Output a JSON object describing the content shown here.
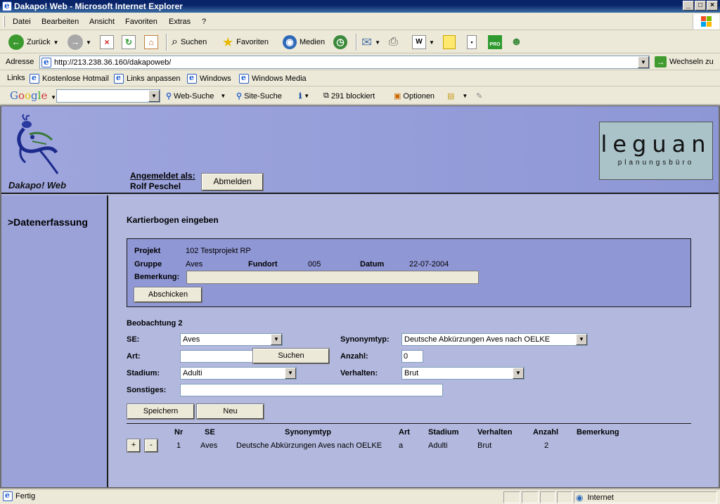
{
  "window": {
    "title": "Dakapo! Web - Microsoft Internet Explorer"
  },
  "menu": [
    "Datei",
    "Bearbeiten",
    "Ansicht",
    "Favoriten",
    "Extras",
    "?"
  ],
  "toolbar": {
    "back": "Zurück",
    "search": "Suchen",
    "favorites": "Favoriten",
    "media": "Medien"
  },
  "address": {
    "label": "Adresse",
    "url": "http://213.238.36.160/dakapoweb/",
    "go": "Wechseln zu"
  },
  "links": {
    "label": "Links",
    "items": [
      "Kostenlose Hotmail",
      "Links anpassen",
      "Windows",
      "Windows Media"
    ]
  },
  "google": {
    "logo": "Google",
    "web_search": "Web-Suche",
    "site_search": "Site-Suche",
    "blocked": "291 blockiert",
    "options": "Optionen"
  },
  "header": {
    "brand": "Dakapo! Web",
    "login_label": "Angemeldet als:",
    "login_name": "Rolf Peschel",
    "logout": "Abmelden",
    "logo_main": "leguan",
    "logo_sub": "planungsbüro"
  },
  "sidebar": {
    "nav_item": ">Datenerfassung"
  },
  "content": {
    "title": "Kartierbogen eingeben",
    "project": {
      "projekt_label": "Projekt",
      "projekt_value": "102 Testprojekt RP",
      "gruppe_label": "Gruppe",
      "gruppe_value": "Aves",
      "fundort_label": "Fundort",
      "fundort_value": "005",
      "datum_label": "Datum",
      "datum_value": "22-07-2004",
      "bemerkung_label": "Bemerkung:",
      "bemerkung_value": "",
      "submit": "Abschicken"
    },
    "observation": {
      "heading": "Beobachtung 2",
      "se_label": "SE:",
      "se_value": "Aves",
      "synonymtyp_label": "Synonymtyp:",
      "synonymtyp_value": "Deutsche Abkürzungen Aves nach OELKE",
      "art_label": "Art:",
      "art_value": "",
      "search_button": "Suchen",
      "anzahl_label": "Anzahl:",
      "anzahl_value": "0",
      "stadium_label": "Stadium:",
      "stadium_value": "Adulti",
      "verhalten_label": "Verhalten:",
      "verhalten_value": "Brut",
      "sonstiges_label": "Sonstiges:",
      "sonstiges_value": "",
      "save": "Speichern",
      "new": "Neu"
    },
    "table": {
      "headers": [
        "Nr",
        "SE",
        "Synonymtyp",
        "Art",
        "Stadium",
        "Verhalten",
        "Anzahl",
        "Bemerkung"
      ],
      "rows": [
        {
          "plus": "+",
          "minus": "-",
          "nr": "1",
          "se": "Aves",
          "synonymtyp": "Deutsche Abkürzungen Aves nach OELKE",
          "art": "a",
          "stadium": "Adulti",
          "verhalten": "Brut",
          "anzahl": "2",
          "bemerkung": ""
        }
      ]
    }
  },
  "status": {
    "left": "Fertig",
    "zone": "Internet"
  }
}
